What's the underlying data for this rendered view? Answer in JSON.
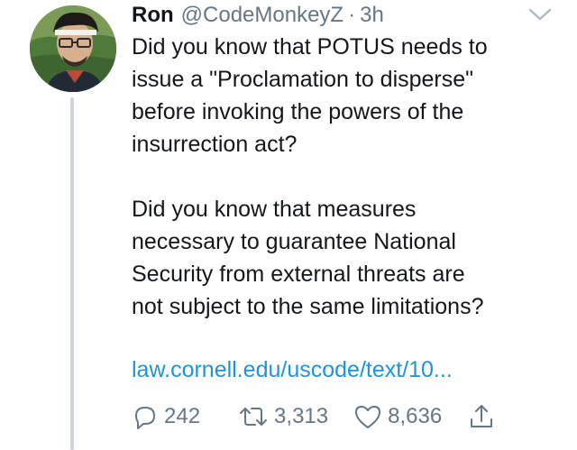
{
  "tweet": {
    "author": {
      "name": "Ron",
      "handle": "@CodeMonkeyZ",
      "separator": "·",
      "time": "3h",
      "avatar_icon": "profile-photo"
    },
    "menu_icon": "chevron-down-icon",
    "paragraphs": [
      "Did you know that POTUS needs to\nissue a \"Proclamation to disperse\"\nbefore invoking the powers of the\ninsurrection act?",
      "Did you know that measures\nnecessary to guarantee National\nSecurity from external threats are\nnot subject to the same limitations?"
    ],
    "link_text": "law.cornell.edu/uscode/text/10...",
    "actions": {
      "replies": "242",
      "retweets": "3,313",
      "likes": "8,636"
    },
    "colors": {
      "link": "#1b95e0",
      "muted": "#657786",
      "thread_line": "#ccd6dd"
    }
  }
}
